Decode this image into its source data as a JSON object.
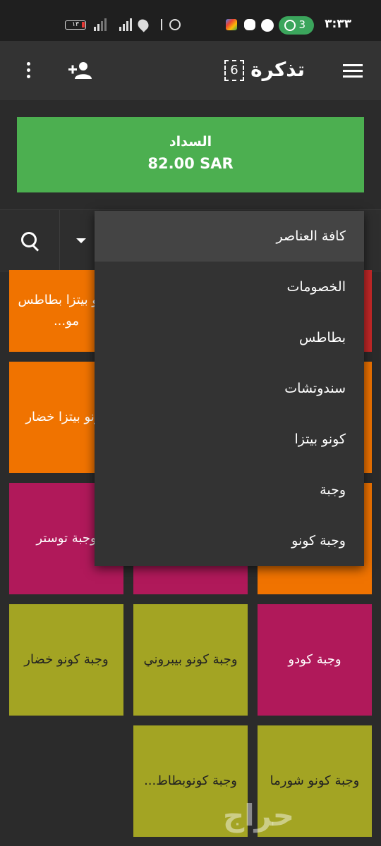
{
  "status_bar": {
    "time": "٣:٣٣",
    "hotspot_count": "3",
    "battery": "١٣",
    "network": "4G"
  },
  "app_bar": {
    "title": "تذكرة",
    "ticket_count": "6"
  },
  "payment": {
    "label": "السداد",
    "amount": "82.00 SAR"
  },
  "dropdown": {
    "items": [
      "كافة العناصر",
      "الخصومات",
      "بطاطس",
      "سندوتشات",
      "كونو بيتزا",
      "وجبة",
      "وجبة كونو"
    ],
    "selected": "كافة العناصر"
  },
  "tiles": [
    {
      "label": "كونو بيتزا بطاطس مو...",
      "color": "#f07300"
    },
    {
      "label": "",
      "color": "#c62828"
    },
    {
      "label": "كونو بيتزا خضار",
      "color": "#f07300"
    },
    {
      "label": "",
      "color": "#f07300"
    },
    {
      "label": "وجبة توستر",
      "color": "#b0195a"
    },
    {
      "label": "",
      "color": "#b0195a"
    },
    {
      "label": "",
      "color": "#f07300"
    },
    {
      "label": "وجبة كونو خضار",
      "color": "#a3a423"
    },
    {
      "label": "وجبة كونو بيبروني",
      "color": "#a3a423"
    },
    {
      "label": "وجبة كودو",
      "color": "#b0195a"
    },
    {
      "label": "وجبة كونوبطاط...",
      "color": "#a3a423"
    },
    {
      "label": "وجبة كونو شورما",
      "color": "#a3a423"
    }
  ],
  "watermark": "حراج",
  "colors": {
    "accent_green": "#4caf50",
    "app_bar": "#333333",
    "background": "#2b2b2b"
  }
}
